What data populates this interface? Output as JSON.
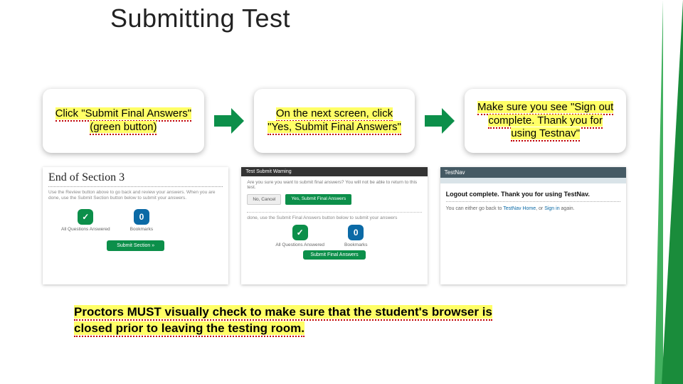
{
  "title": "Submitting Test",
  "steps": {
    "s1": "Click \"Submit Final Answers\" (green button)",
    "s2": "On the next screen, click \"Yes, Submit Final Answers\"",
    "s3": "Make sure you see \"Sign out complete. Thank you for using Testnav\""
  },
  "shot1": {
    "heading": "End of Section 3",
    "sub": "Use the Review button above to go back and review your answers. When you are done, use the Submit Section button below to submit your answers.",
    "all_q": "All Questions Answered",
    "bookmarks_count": "0",
    "bookmarks": "Bookmarks",
    "button": "Submit Section   »"
  },
  "shot2": {
    "heading": "Test Submit Warning",
    "sub": "Are you sure you want to submit final answers? You will not be able to return to this test.",
    "no": "No, Cancel",
    "yes": "Yes, Submit Final Answers",
    "msg": "done, use the Submit Final Answers button below to submit your answers",
    "all_q": "All Questions Answered",
    "bookmarks_count": "0",
    "bookmarks": "Bookmarks",
    "button": "Submit Final Answers"
  },
  "shot3": {
    "brand": "TestNav",
    "msg": "Logout complete. Thank you for using TestNav.",
    "sub_pre": "You can either go back to ",
    "link1": "TestNav Home",
    "sub_mid": ", or ",
    "link2": "Sign in",
    "sub_post": " again."
  },
  "note": "Proctors MUST visually check to make sure that the student's browser is closed prior to leaving the testing room."
}
